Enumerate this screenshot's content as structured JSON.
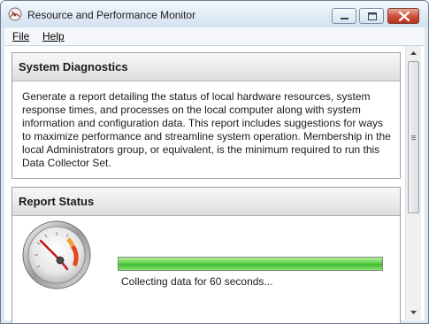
{
  "window": {
    "title": "Resource and Performance Monitor",
    "icon": "resource-monitor-icon"
  },
  "menubar": {
    "file_label": "File",
    "help_label": "Help"
  },
  "system_diagnostics": {
    "title": "System Diagnostics",
    "description": "Generate a report detailing the status of local hardware resources, system response times, and processes on the local computer along with system information and configuration data. This report includes suggestions for ways to maximize performance and streamline system operation. Membership in the local Administrators group, or equivalent, is the minimum required to run this Data Collector Set."
  },
  "report_status": {
    "title": "Report Status",
    "status_text": "Collecting data for 60 seconds...",
    "progress_fraction": 1.0,
    "gauge_icon": "gauge-icon"
  },
  "colors": {
    "progress_green": "#4fc83c",
    "close_red": "#c8442c",
    "panel_border": "#9aa2aa"
  }
}
